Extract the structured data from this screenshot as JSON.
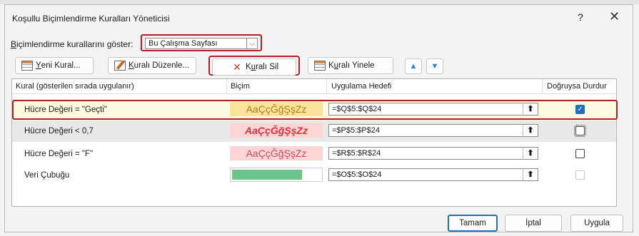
{
  "dialog": {
    "title": "Koşullu Biçimlendirme Kuralları Yöneticisi",
    "help": "?",
    "close": "✕"
  },
  "show": {
    "label_prefix": "B",
    "label_rest": "içimlendirme kurallarını göster:",
    "selected": "Bu Çalışma Sayfası"
  },
  "toolbar": {
    "new_rule_u": "Y",
    "new_rule_rest": "eni Kural...",
    "edit_rule_u": "K",
    "edit_rule_rest": "uralı Düzenle...",
    "delete_rule_pre": "K",
    "delete_rule_u": "u",
    "delete_rule_rest": "ralı Sil",
    "duplicate_pre": "K",
    "duplicate_u": "u",
    "duplicate_rest": "ralı Yinele",
    "move_up": "^",
    "move_down": "v"
  },
  "table": {
    "headers": [
      "Kural (gösterilen sırada uygulanır)",
      "Biçim",
      "Uygulama Hedefi",
      "Doğruysa Durdur"
    ],
    "rows": [
      {
        "rule": "Hücre Değeri = \"Geçti\"",
        "format": "AaÇçĞğŞşZz",
        "target": "=$Q$5:$Q$24",
        "stop": true
      },
      {
        "rule": "Hücre Değeri < 0,7",
        "format": "AaÇçĞğŞşZz",
        "target": "=$P$5:$P$24",
        "stop": false
      },
      {
        "rule": "Hücre Değeri = \"F\"",
        "format": "AaÇçĞğŞşZz",
        "target": "=$R$5:$R$24",
        "stop": false
      },
      {
        "rule": "Veri Çubuğu",
        "format": "",
        "target": "=$O$5:$O$24",
        "stop": false
      }
    ]
  },
  "footer": {
    "ok": "Tamam",
    "cancel": "İptal",
    "apply": "Uygula"
  },
  "colors": {
    "highlight": "#b21f24",
    "accent": "#1f6fbf",
    "databar": "#69c58a"
  }
}
